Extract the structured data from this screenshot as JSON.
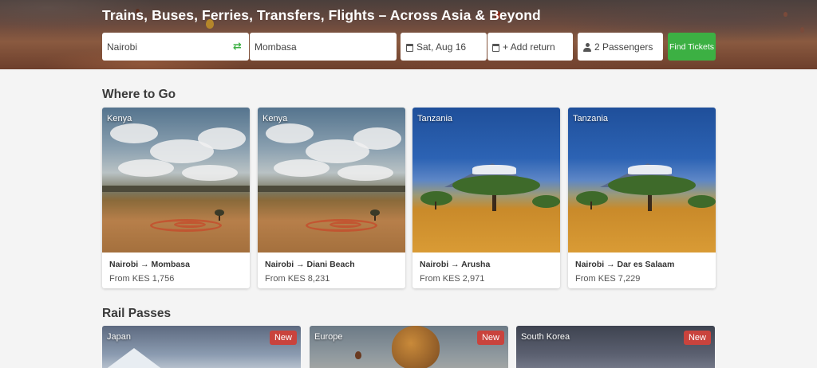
{
  "hero": {
    "title": "Trains, Buses, Ferries, Transfers, Flights – Across Asia & Beyond"
  },
  "search": {
    "from": "Nairobi",
    "to": "Mombasa",
    "date": "Sat, Aug 16",
    "return_label": "+ Add return",
    "passengers": "2 Passengers",
    "find_button": "Find Tickets",
    "swap_icon": "swap-arrows-icon",
    "date_icon": "calendar-icon",
    "passenger_icon": "user-icon"
  },
  "where_to_go": {
    "title": "Where to Go",
    "cards": [
      {
        "country": "Kenya",
        "route": "Nairobi → Mombasa",
        "price": "From KES 1,756"
      },
      {
        "country": "Kenya",
        "route": "Nairobi → Diani Beach",
        "price": "From KES 8,231"
      },
      {
        "country": "Tanzania",
        "route": "Nairobi → Arusha",
        "price": "From KES 2,971"
      },
      {
        "country": "Tanzania",
        "route": "Nairobi → Dar es Salaam",
        "price": "From KES 7,229"
      }
    ]
  },
  "rail_passes": {
    "title": "Rail Passes",
    "passes": [
      {
        "country": "Japan",
        "badge": "New"
      },
      {
        "country": "Europe",
        "badge": "New"
      },
      {
        "country": "South Korea",
        "badge": "New"
      }
    ]
  },
  "colors": {
    "accent_green": "#3cb043",
    "badge_red": "#c9433d"
  }
}
